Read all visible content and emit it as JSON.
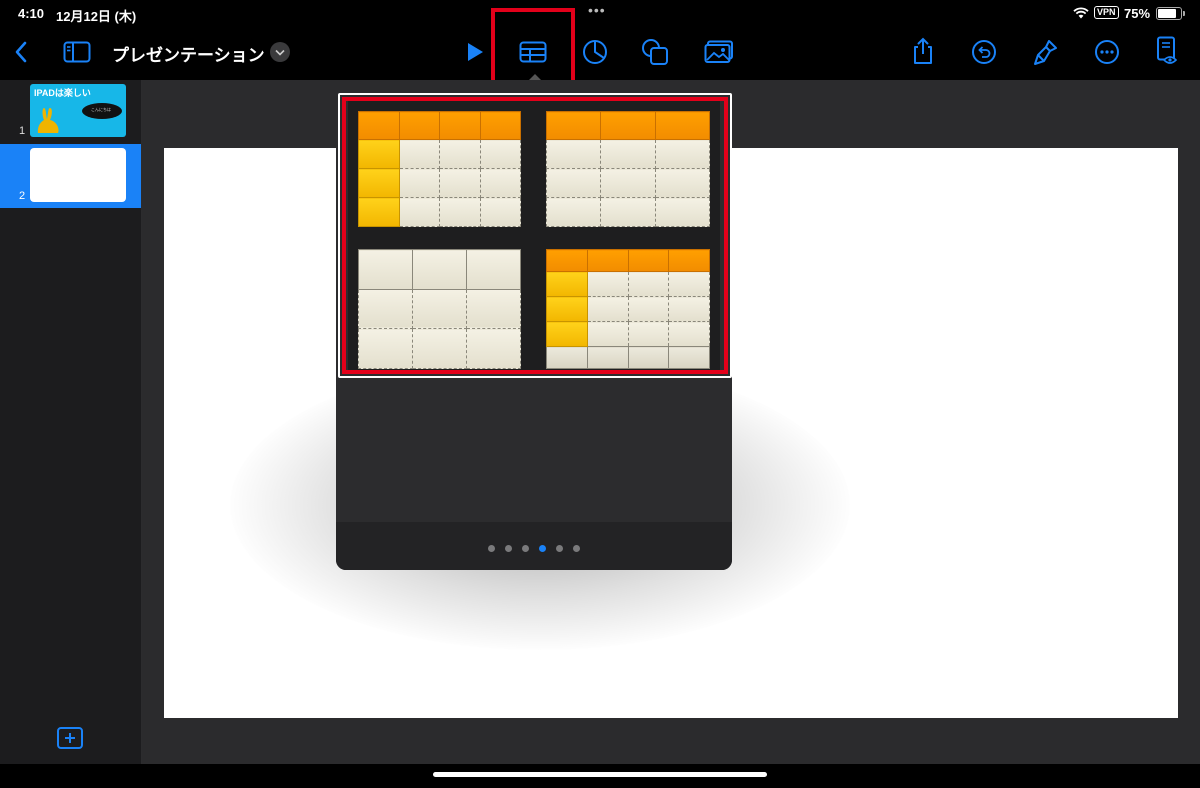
{
  "status_bar": {
    "time": "4:10",
    "date": "12月12日 (木)",
    "vpn": "VPN",
    "battery": "75%",
    "battery_level": 0.75
  },
  "toolbar": {
    "title": "プレゼンテーション",
    "accent_color": "#1a82f7",
    "icons": [
      "back-chevron",
      "sidebar",
      "play",
      "table",
      "chart",
      "shape",
      "media",
      "share",
      "undo",
      "format-brush",
      "more",
      "presenter-notes"
    ]
  },
  "sidebar": {
    "slides": [
      {
        "number": "1",
        "title": "IPADは楽しい",
        "bubble_text": "こんにちは",
        "selected": false
      },
      {
        "number": "2",
        "selected": true
      }
    ]
  },
  "table_popover": {
    "page_count": 6,
    "current_page": 4,
    "styles": [
      "orange-header-yellow-side",
      "orange-header",
      "plain",
      "orange-header-yellow-side-footer"
    ]
  },
  "highlight_color": "#e3001a"
}
